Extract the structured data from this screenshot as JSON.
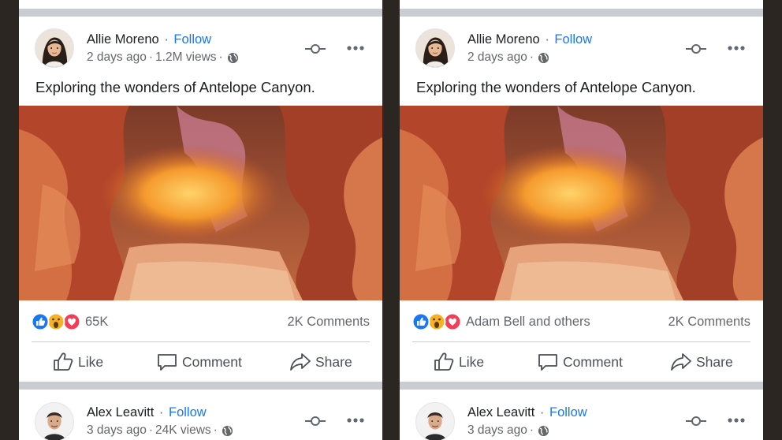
{
  "panels": [
    {
      "post": {
        "author": "Allie Moreno",
        "follow_label": "Follow",
        "separator": "·",
        "time": "2 days ago",
        "views": "1.2M views",
        "caption": "Exploring the wonders of Antelope Canyon.",
        "reaction_summary": "65K",
        "comments": "2K Comments"
      },
      "next_post": {
        "author": "Alex Leavitt",
        "follow_label": "Follow",
        "separator": "·",
        "time": "3 days ago",
        "views": "24K views"
      }
    },
    {
      "post": {
        "author": "Allie Moreno",
        "follow_label": "Follow",
        "separator": "·",
        "time": "2 days ago",
        "views": "",
        "caption": "Exploring the wonders of Antelope Canyon.",
        "reaction_summary": "Adam Bell and others",
        "comments": "2K Comments"
      },
      "next_post": {
        "author": "Alex Leavitt",
        "follow_label": "Follow",
        "separator": "·",
        "time": "3 days ago",
        "views": ""
      }
    }
  ],
  "actions": {
    "like": "Like",
    "comment": "Comment",
    "share": "Share"
  },
  "icons": {
    "reactions": [
      "like-reaction-icon",
      "wow-reaction-icon",
      "love-reaction-icon"
    ],
    "privacy": "globe-icon",
    "pin": "pin-icon",
    "menu": "more-options-icon"
  },
  "colors": {
    "follow": "#1877f2",
    "like_reaction": "#1877f2",
    "wow_reaction": "#f7b125",
    "love_reaction": "#f33e58",
    "feed_background": "#c9ccd1"
  }
}
